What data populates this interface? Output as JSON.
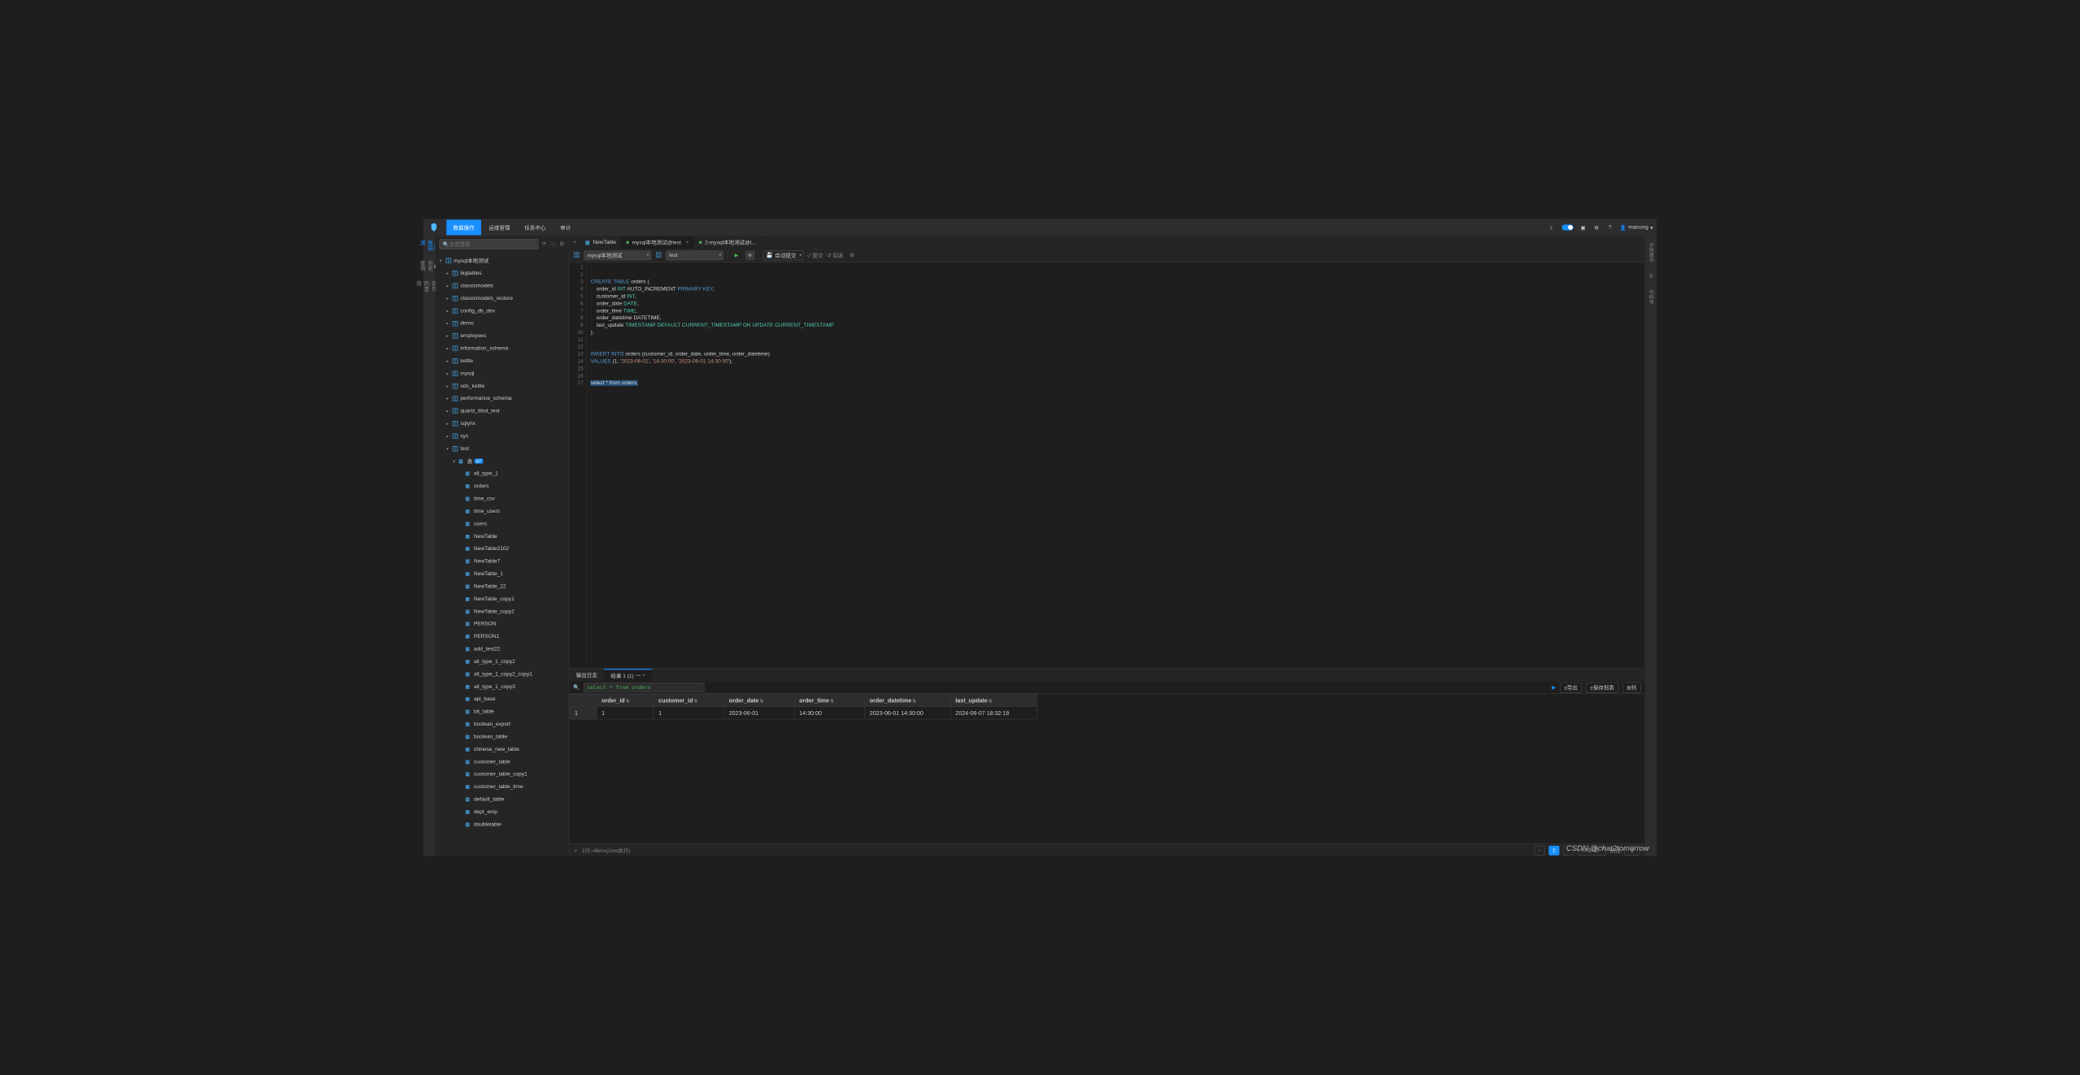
{
  "topnav": {
    "items": [
      "数据操作",
      "运维管理",
      "任务中心",
      "审计"
    ],
    "active": 0
  },
  "user": {
    "name": "maicong"
  },
  "search": {
    "placeholder": "点击搜索"
  },
  "leftrail": [
    "数据源",
    "字段",
    "历史查询",
    "",
    "保存的查询"
  ],
  "rightrail": [
    "字段提示",
    "",
    "重载",
    "",
    "代码块"
  ],
  "tree": {
    "root": "mysql本地测试",
    "databases": [
      "bigtables",
      "classicmodels",
      "classicmodels_restore",
      "config_db_dev",
      "demo",
      "employees",
      "information_schema",
      "kettle",
      "mysql",
      "ods_kettle",
      "performance_schema",
      "quartz_tibot_test",
      "sqlynx",
      "sys",
      "test"
    ],
    "expanded": "test",
    "tablesGroup": {
      "label": "表",
      "badge": "87"
    },
    "tables": [
      "all_type_1",
      "orders",
      "time_csv",
      "time_users",
      "users",
      "NewTable",
      "NewTable2102",
      "NewTable7",
      "NewTable_1",
      "NewTable_22",
      "NewTable_copy1",
      "NewTable_copy2",
      "PERSON",
      "PERSON1",
      "add_test22",
      "all_type_1_copy2",
      "all_type_1_copy2_copy1",
      "all_type_1_copy3",
      "api_base",
      "bit_table",
      "boolean_export",
      "boolean_table",
      "chinese_new_table",
      "customer_table",
      "customer_table_copy1",
      "customer_table_time",
      "default_table",
      "dept_emp",
      "doubletable"
    ]
  },
  "tabs": [
    {
      "label": "NewTable",
      "icon": "table",
      "active": false
    },
    {
      "label": "mysql本地测试@test",
      "icon": "dot",
      "active": true
    },
    {
      "label": "2-mysql本地测试@t...",
      "icon": "dot",
      "active": false
    }
  ],
  "toolbar": {
    "datasource": "mysql本地测试",
    "database": "test",
    "autocommit": "自动提交",
    "commit": "提交",
    "rollback": "回滚"
  },
  "editor": {
    "lines": 17,
    "code_parts": [
      [
        ""
      ],
      [
        ""
      ],
      [
        {
          "t": "CREATE TABLE",
          "c": "kw"
        },
        {
          "t": " orders ("
        }
      ],
      [
        {
          "t": "    order_id "
        },
        {
          "t": "INT",
          "c": "ty"
        },
        {
          "t": " AUTO_INCREMENT "
        },
        {
          "t": "PRIMARY KEY",
          "c": "kw"
        },
        {
          "t": ","
        }
      ],
      [
        {
          "t": "    customer_id "
        },
        {
          "t": "INT",
          "c": "ty"
        },
        {
          "t": ","
        }
      ],
      [
        {
          "t": "    order_date "
        },
        {
          "t": "DATE",
          "c": "ty"
        },
        {
          "t": ","
        }
      ],
      [
        {
          "t": "    order_time "
        },
        {
          "t": "TIME",
          "c": "ty"
        },
        {
          "t": ","
        }
      ],
      [
        {
          "t": "    order_datetime DATETIME,"
        }
      ],
      [
        {
          "t": "    last_update "
        },
        {
          "t": "TIMESTAMP DEFAULT CURRENT_TIMESTAMP ON UPDATE CURRENT_TIMESTAMP",
          "c": "ty"
        }
      ],
      [
        {
          "t": ");"
        }
      ],
      [
        ""
      ],
      [
        ""
      ],
      [
        {
          "t": "INSERT INTO",
          "c": "kw"
        },
        {
          "t": " orders (customer_id, order_date, order_time, order_datetime)"
        }
      ],
      [
        {
          "t": "VALUES",
          "c": "kw"
        },
        {
          "t": " (1, "
        },
        {
          "t": "'2023-06-01'",
          "c": "str"
        },
        {
          "t": ", "
        },
        {
          "t": "'14:30:00'",
          "c": "str"
        },
        {
          "t": ", "
        },
        {
          "t": "'2023-06-01 14:30:00'",
          "c": "str"
        },
        {
          "t": ");"
        }
      ],
      [
        ""
      ],
      [
        ""
      ],
      [
        {
          "t": "select * from ",
          "c": "sel"
        },
        {
          "t": "orders;",
          "c": "sel",
          "bold": true
        }
      ]
    ]
  },
  "results": {
    "tabs": [
      {
        "label": "输出日志",
        "active": false
      },
      {
        "label": "结果 1 (1)",
        "active": true
      }
    ],
    "filter": "select * from orders",
    "exportBtn": "±导出",
    "saveBtn": "±保存到表",
    "colBtn": "⊞列",
    "columns": [
      "order_id",
      "customer_id",
      "order_date",
      "order_time",
      "order_datetime",
      "last_update"
    ],
    "widths": [
      56,
      118,
      146,
      146,
      146,
      178,
      180
    ],
    "rows": [
      [
        "1",
        "1",
        "1",
        "2023-06-01",
        "14:30:00",
        "2023-06-01 14:30:00",
        "2024-06-07 18:32:19"
      ]
    ],
    "status": "1行~46ms(1ms执行)",
    "pagesize": "50条/页",
    "goto": "前往",
    "page": "1"
  },
  "watermark": "CSDN @chat2tomorrow"
}
